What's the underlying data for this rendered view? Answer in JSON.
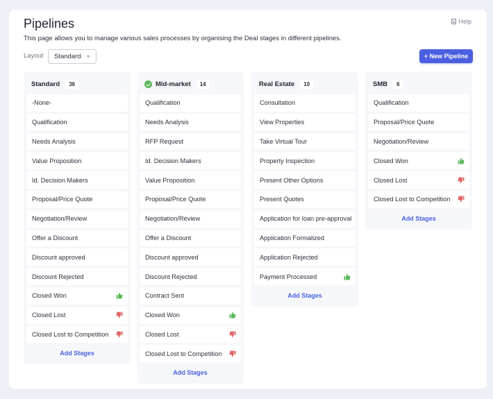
{
  "page": {
    "title": "Pipelines",
    "help_label": "Help",
    "description": "This page allows you to manage various sales processes by organising the Deal stages in different pipelines.",
    "layout_label": "Layout",
    "layout_value": "Standard",
    "new_pipeline_label": "+ New Pipeline"
  },
  "colors": {
    "accent": "#4a5fe0",
    "won": "#5cb85c",
    "lost": "#e06666"
  },
  "pipelines": [
    {
      "name": "Standard",
      "count": "36",
      "default": false,
      "add_label": "Add Stages",
      "stages": [
        {
          "label": "-None-",
          "icon": ""
        },
        {
          "label": "Qualification",
          "icon": ""
        },
        {
          "label": "Needs Analysis",
          "icon": ""
        },
        {
          "label": "Value Proposition",
          "icon": ""
        },
        {
          "label": "Id. Decision Makers",
          "icon": ""
        },
        {
          "label": "Proposal/Price Quote",
          "icon": ""
        },
        {
          "label": "Negotiation/Review",
          "icon": ""
        },
        {
          "label": "Offer a Discount",
          "icon": ""
        },
        {
          "label": "Discount approved",
          "icon": ""
        },
        {
          "label": "Discount Rejected",
          "icon": ""
        },
        {
          "label": "Closed Won",
          "icon": "thumbs-up-icon"
        },
        {
          "label": "Closed Lost",
          "icon": "thumbs-down-icon"
        },
        {
          "label": "Closed Lost to Competition",
          "icon": "thumbs-down-icon"
        }
      ]
    },
    {
      "name": "Mid-market",
      "count": "14",
      "default": true,
      "add_label": "Add Stages",
      "stages": [
        {
          "label": "Qualification",
          "icon": ""
        },
        {
          "label": "Needs Analysis",
          "icon": ""
        },
        {
          "label": "RFP Request",
          "icon": ""
        },
        {
          "label": "Id. Decision Makers",
          "icon": ""
        },
        {
          "label": "Value Proposition",
          "icon": ""
        },
        {
          "label": "Proposal/Price Quote",
          "icon": ""
        },
        {
          "label": "Negotiation/Review",
          "icon": ""
        },
        {
          "label": "Offer a Discount",
          "icon": ""
        },
        {
          "label": "Discount approved",
          "icon": ""
        },
        {
          "label": "Discount Rejected",
          "icon": ""
        },
        {
          "label": "Contract Sent",
          "icon": ""
        },
        {
          "label": "Closed Won",
          "icon": "thumbs-up-icon"
        },
        {
          "label": "Closed Lost",
          "icon": "thumbs-down-icon"
        },
        {
          "label": "Closed Lost to Competition",
          "icon": "thumbs-down-icon"
        }
      ]
    },
    {
      "name": "Real Estate",
      "count": "10",
      "default": false,
      "add_label": "Add Stages",
      "stages": [
        {
          "label": "Consultation",
          "icon": ""
        },
        {
          "label": "View Properties",
          "icon": ""
        },
        {
          "label": "Take Virtual Tour",
          "icon": ""
        },
        {
          "label": "Property Inspection",
          "icon": ""
        },
        {
          "label": "Present Other Options",
          "icon": ""
        },
        {
          "label": "Present Quotes",
          "icon": ""
        },
        {
          "label": "Application for loan pre-approval",
          "icon": ""
        },
        {
          "label": "Application Formalized",
          "icon": ""
        },
        {
          "label": "Application Rejected",
          "icon": ""
        },
        {
          "label": "Payment Processed",
          "icon": "thumbs-up-icon"
        }
      ]
    },
    {
      "name": "SMB",
      "count": "6",
      "default": false,
      "add_label": "Add Stages",
      "stages": [
        {
          "label": "Qualification",
          "icon": ""
        },
        {
          "label": "Proposal/Price Quote",
          "icon": ""
        },
        {
          "label": "Negotiation/Review",
          "icon": ""
        },
        {
          "label": "Closed Won",
          "icon": "thumbs-up-icon"
        },
        {
          "label": "Closed Lost",
          "icon": "thumbs-down-icon"
        },
        {
          "label": "Closed Lost to Competition",
          "icon": "thumbs-down-icon"
        }
      ]
    }
  ]
}
